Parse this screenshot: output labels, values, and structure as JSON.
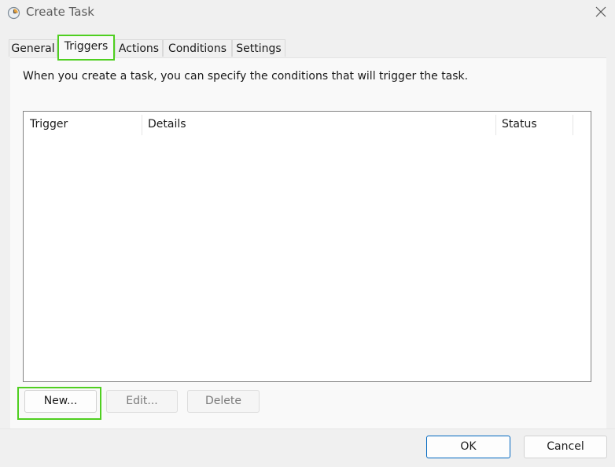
{
  "window": {
    "title": "Create Task",
    "icon": "scheduler-clock-icon",
    "close_icon": "close-icon"
  },
  "tabs": [
    {
      "label": "General",
      "active": false
    },
    {
      "label": "Triggers",
      "active": true
    },
    {
      "label": "Actions",
      "active": false
    },
    {
      "label": "Conditions",
      "active": false
    },
    {
      "label": "Settings",
      "active": false
    }
  ],
  "triggers_page": {
    "instruction": "When you create a task, you can specify the conditions that will trigger the task.",
    "columns": [
      "Trigger",
      "Details",
      "Status"
    ],
    "rows": [],
    "buttons": {
      "new": "New...",
      "edit": "Edit...",
      "delete": "Delete"
    }
  },
  "dialog_buttons": {
    "ok": "OK",
    "cancel": "Cancel"
  },
  "colors": {
    "highlight": "#4fcf20",
    "ok_border": "#0067c0"
  }
}
